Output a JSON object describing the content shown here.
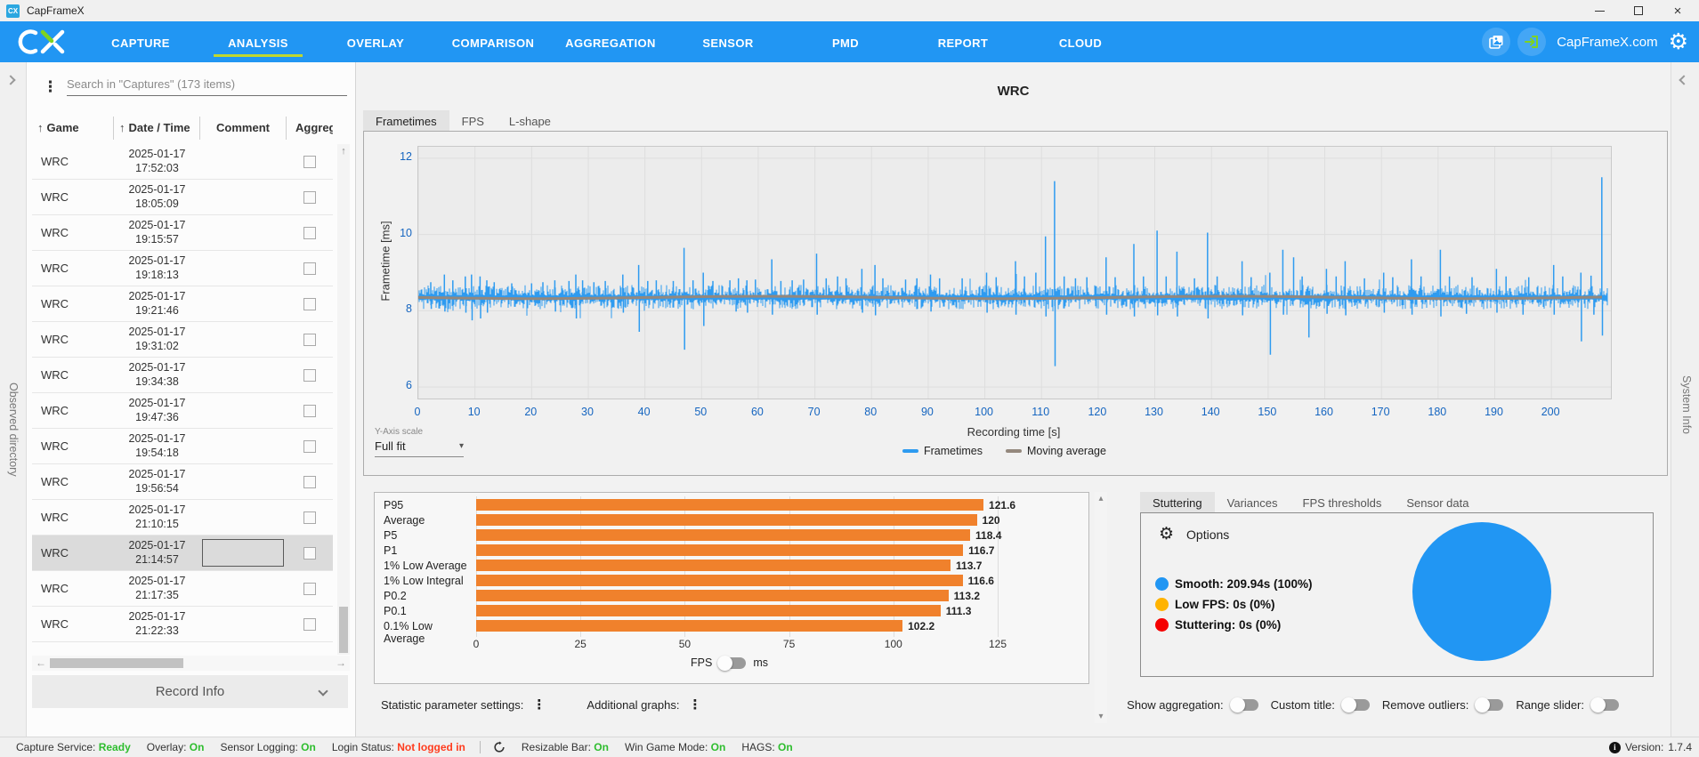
{
  "titlebar": {
    "title": "CapFrameX"
  },
  "navbar": {
    "tabs": [
      "CAPTURE",
      "ANALYSIS",
      "OVERLAY",
      "COMPARISON",
      "AGGREGATION",
      "SENSOR",
      "PMD",
      "REPORT",
      "CLOUD"
    ],
    "active_tab": "ANALYSIS",
    "site_link": "CapFrameX.com",
    "accent_color": "#2196F3",
    "active_underline_color": "#BFD72F"
  },
  "left_strip": {
    "label": "Observed directory"
  },
  "right_strip": {
    "label": "System Info"
  },
  "capture_list": {
    "search_placeholder": "Search in \"Captures\" (173 items)",
    "columns": [
      "Game",
      "Date / Time",
      "Comment",
      "Aggreg"
    ],
    "sorted_columns": [
      "Game",
      "Date / Time"
    ],
    "rows": [
      {
        "game": "WRC",
        "date": "2025-01-17",
        "time": "17:52:03",
        "selected": false
      },
      {
        "game": "WRC",
        "date": "2025-01-17",
        "time": "18:05:09",
        "selected": false
      },
      {
        "game": "WRC",
        "date": "2025-01-17",
        "time": "19:15:57",
        "selected": false
      },
      {
        "game": "WRC",
        "date": "2025-01-17",
        "time": "19:18:13",
        "selected": false
      },
      {
        "game": "WRC",
        "date": "2025-01-17",
        "time": "19:21:46",
        "selected": false
      },
      {
        "game": "WRC",
        "date": "2025-01-17",
        "time": "19:31:02",
        "selected": false
      },
      {
        "game": "WRC",
        "date": "2025-01-17",
        "time": "19:34:38",
        "selected": false
      },
      {
        "game": "WRC",
        "date": "2025-01-17",
        "time": "19:47:36",
        "selected": false
      },
      {
        "game": "WRC",
        "date": "2025-01-17",
        "time": "19:54:18",
        "selected": false
      },
      {
        "game": "WRC",
        "date": "2025-01-17",
        "time": "19:56:54",
        "selected": false
      },
      {
        "game": "WRC",
        "date": "2025-01-17",
        "time": "21:10:15",
        "selected": false
      },
      {
        "game": "WRC",
        "date": "2025-01-17",
        "time": "21:14:57",
        "selected": true
      },
      {
        "game": "WRC",
        "date": "2025-01-17",
        "time": "21:17:35",
        "selected": false
      },
      {
        "game": "WRC",
        "date": "2025-01-17",
        "time": "21:22:33",
        "selected": false
      }
    ],
    "footer_label": "Record Info"
  },
  "analysis": {
    "page_title": "WRC",
    "tabs": [
      "Frametimes",
      "FPS",
      "L-shape"
    ],
    "active_tab": "Frametimes",
    "y_axis_scale_label": "Y-Axis scale",
    "y_axis_scale_value": "Full fit",
    "legend": [
      {
        "label": "Frametimes",
        "color": "#2E9BF0"
      },
      {
        "label": "Moving average",
        "color": "#94887D"
      }
    ]
  },
  "chart_data": [
    {
      "type": "line",
      "title": "WRC",
      "xlabel": "Recording time [s]",
      "ylabel": "Frametime [ms]",
      "xlim": [
        0,
        210.5
      ],
      "ylim": [
        5.7,
        12.3
      ],
      "x_ticks": [
        0,
        10,
        20,
        30,
        40,
        50,
        60,
        70,
        80,
        90,
        100,
        110,
        120,
        130,
        140,
        150,
        160,
        170,
        180,
        190,
        200
      ],
      "y_ticks": [
        6,
        8,
        10,
        12
      ],
      "grid": true,
      "legend_position": "bottom",
      "series": [
        {
          "name": "Frametimes",
          "color": "#2E9BF0",
          "baseline_ms": 8.35,
          "noise_band_ms": [
            8.05,
            8.65
          ],
          "spikes_up": [
            [
              2.2,
              8.75
            ],
            [
              4.6,
              8.95
            ],
            [
              6.1,
              8.8
            ],
            [
              8.3,
              8.9
            ],
            [
              9.4,
              8.95
            ],
            [
              10.9,
              8.9
            ],
            [
              12.1,
              8.8
            ],
            [
              13.4,
              8.75
            ],
            [
              16.5,
              8.72
            ],
            [
              20,
              8.72
            ],
            [
              22,
              8.75
            ],
            [
              24.1,
              8.8
            ],
            [
              26.6,
              8.78
            ],
            [
              27.8,
              8.95
            ],
            [
              29,
              8.8
            ],
            [
              31,
              8.75
            ],
            [
              33,
              8.78
            ],
            [
              36.1,
              8.95
            ],
            [
              38.9,
              9.2
            ],
            [
              40.5,
              8.78
            ],
            [
              42,
              8.8
            ],
            [
              45,
              8.78
            ],
            [
              46.9,
              9.65
            ],
            [
              48.5,
              8.8
            ],
            [
              50.3,
              9.0
            ],
            [
              52,
              8.78
            ],
            [
              55,
              8.8
            ],
            [
              56.5,
              8.85
            ],
            [
              58,
              8.8
            ],
            [
              59.5,
              8.82
            ],
            [
              62.4,
              9.35
            ],
            [
              64,
              8.78
            ],
            [
              66,
              8.8
            ],
            [
              68,
              8.82
            ],
            [
              70.3,
              9.5
            ],
            [
              72,
              8.85
            ],
            [
              74,
              8.9
            ],
            [
              75.5,
              8.85
            ],
            [
              78.3,
              9.1
            ],
            [
              80.6,
              9.2
            ],
            [
              82,
              8.85
            ],
            [
              86,
              8.82
            ],
            [
              88,
              8.85
            ],
            [
              90.4,
              8.95
            ],
            [
              92,
              8.85
            ],
            [
              96,
              8.85
            ],
            [
              100.3,
              9.0
            ],
            [
              102,
              8.88
            ],
            [
              105.4,
              9.3
            ],
            [
              107,
              8.9
            ],
            [
              109,
              9.0
            ],
            [
              110.7,
              9.95
            ],
            [
              112.3,
              11.4
            ],
            [
              114,
              8.9
            ],
            [
              116,
              8.85
            ],
            [
              118,
              8.88
            ],
            [
              121.4,
              9.4
            ],
            [
              123,
              8.88
            ],
            [
              126.3,
              9.75
            ],
            [
              128,
              8.9
            ],
            [
              130.4,
              10.1
            ],
            [
              132,
              8.9
            ],
            [
              133.9,
              9.55
            ],
            [
              137,
              8.85
            ],
            [
              139.3,
              10.05
            ],
            [
              141,
              8.9
            ],
            [
              145.4,
              9.3
            ],
            [
              147,
              8.88
            ],
            [
              150.3,
              9.0
            ],
            [
              152.6,
              9.6
            ],
            [
              154.5,
              9.4
            ],
            [
              156,
              8.9
            ],
            [
              160.3,
              9.1
            ],
            [
              162,
              8.9
            ],
            [
              163.6,
              9.3
            ],
            [
              167,
              8.85
            ],
            [
              170.4,
              9.0
            ],
            [
              172,
              8.88
            ],
            [
              175.3,
              9.35
            ],
            [
              177,
              8.9
            ],
            [
              180.4,
              9.6
            ],
            [
              182,
              8.9
            ],
            [
              186,
              8.88
            ],
            [
              190.3,
              9.1
            ],
            [
              192,
              8.9
            ],
            [
              196,
              8.88
            ],
            [
              200.4,
              9.2
            ],
            [
              202,
              8.9
            ],
            [
              205.2,
              9.0
            ],
            [
              207,
              8.92
            ],
            [
              208.9,
              11.5
            ]
          ],
          "spikes_down": [
            [
              2.3,
              8.05
            ],
            [
              4.7,
              7.98
            ],
            [
              8.4,
              7.95
            ],
            [
              9.5,
              7.75
            ],
            [
              11,
              7.8
            ],
            [
              12.2,
              7.95
            ],
            [
              24.2,
              7.98
            ],
            [
              27.9,
              7.8
            ],
            [
              36.2,
              7.95
            ],
            [
              39,
              7.45
            ],
            [
              47,
              6.98
            ],
            [
              50.4,
              7.6
            ],
            [
              56.1,
              7.98
            ],
            [
              58.1,
              7.95
            ],
            [
              62.5,
              7.9
            ],
            [
              70.4,
              7.9
            ],
            [
              78.4,
              7.95
            ],
            [
              80.7,
              7.88
            ],
            [
              90.5,
              7.98
            ],
            [
              100.4,
              7.95
            ],
            [
              105.5,
              7.9
            ],
            [
              110.8,
              7.85
            ],
            [
              112.4,
              6.55
            ],
            [
              121.5,
              7.9
            ],
            [
              126.4,
              7.85
            ],
            [
              130.5,
              7.88
            ],
            [
              134,
              7.85
            ],
            [
              139.4,
              7.8
            ],
            [
              145.5,
              7.88
            ],
            [
              150.4,
              6.85
            ],
            [
              152.7,
              7.9
            ],
            [
              157.2,
              7.3
            ],
            [
              160.4,
              7.92
            ],
            [
              163.7,
              7.88
            ],
            [
              170.5,
              7.95
            ],
            [
              175.4,
              7.9
            ],
            [
              180.5,
              7.85
            ],
            [
              185,
              7.92
            ],
            [
              190.4,
              7.95
            ],
            [
              195,
              7.9
            ],
            [
              200.5,
              7.9
            ],
            [
              205.3,
              7.2
            ],
            [
              207.5,
              7.9
            ],
            [
              209,
              7.35
            ]
          ]
        },
        {
          "name": "Moving average",
          "color": "#94887D",
          "approx_value_ms": 8.35
        }
      ]
    },
    {
      "type": "bar",
      "orientation": "horizontal",
      "categories": [
        "P95",
        "Average",
        "P5",
        "P1",
        "1% Low Average",
        "1% Low Integral",
        "P0.2",
        "P0.1",
        "0.1% Low Average"
      ],
      "values": [
        121.6,
        120,
        118.4,
        116.7,
        113.7,
        116.6,
        113.2,
        111.3,
        102.2
      ],
      "x_ticks": [
        0,
        25,
        50,
        75,
        100,
        125
      ],
      "xlim": [
        0,
        127
      ],
      "bar_color": "#F0812C",
      "unit_toggle": {
        "left": "FPS",
        "right": "ms",
        "selected": "FPS"
      }
    },
    {
      "type": "pie",
      "slices": [
        {
          "label": "Smooth",
          "seconds": "209.94s",
          "percent": "100%",
          "value": 100,
          "color": "#2196F3"
        },
        {
          "label": "Low FPS",
          "seconds": "0s",
          "percent": "0%",
          "value": 0,
          "color": "#FFB300"
        },
        {
          "label": "Stuttering",
          "seconds": "0s",
          "percent": "0%",
          "value": 0,
          "color": "#F50000"
        }
      ]
    }
  ],
  "stutter_panel": {
    "tabs": [
      "Stuttering",
      "Variances",
      "FPS thresholds",
      "Sensor data"
    ],
    "active_tab": "Stuttering",
    "options_label": "Options"
  },
  "bottom_bar": {
    "statistic_label": "Statistic parameter settings:",
    "graphs_label": "Additional graphs:",
    "toggles": [
      "Show aggregation:",
      "Custom title:",
      "Remove outliers:",
      "Range slider:"
    ]
  },
  "statusbar": {
    "items_left": [
      {
        "label": "Capture Service:",
        "value": "Ready",
        "value_color": "#2EBD2E"
      },
      {
        "label": "Overlay:",
        "value": "On",
        "value_color": "#2EBD2E"
      },
      {
        "label": "Sensor Logging:",
        "value": "On",
        "value_color": "#2EBD2E"
      },
      {
        "label": "Login Status:",
        "value": "Not logged in",
        "value_color": "#FF3C1E"
      }
    ],
    "items_right": [
      {
        "label": "Resizable Bar:",
        "value": "On",
        "value_color": "#2EBD2E"
      },
      {
        "label": "Win Game Mode:",
        "value": "On",
        "value_color": "#2EBD2E"
      },
      {
        "label": "HAGS:",
        "value": "On",
        "value_color": "#2EBD2E"
      }
    ],
    "version_label": "Version:",
    "version_value": "1.7.4"
  }
}
